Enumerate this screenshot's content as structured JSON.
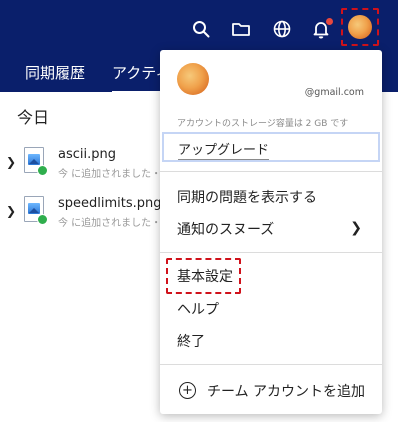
{
  "tabs": [
    {
      "label": "同期履歴"
    },
    {
      "label": "アクティ"
    }
  ],
  "section": {
    "today": "今日"
  },
  "files": [
    {
      "name": "ascii.png",
      "sub": "今 に追加されました・"
    },
    {
      "name": "speedlimits.png",
      "sub": "今 に追加されました・"
    }
  ],
  "account": {
    "email": "@gmail.com",
    "storage": "アカウントのストレージ容量は 2 GB です"
  },
  "menu": {
    "upgrade": "アップグレード",
    "sync_issues": "同期の問題を表示する",
    "snooze": "通知のスヌーズ",
    "settings": "基本設定",
    "help": "ヘルプ",
    "quit": "終了",
    "add_team": "チーム アカウントを追加"
  },
  "icons": {
    "search": "search-icon",
    "folder": "folder-icon",
    "globe": "globe-icon",
    "bell": "bell-icon",
    "avatar": "avatar",
    "chevron": "chevron-right-icon",
    "add": "plus-circle-icon"
  },
  "colors": {
    "header_bg": "#0a1f6b",
    "highlight": "#d0121b",
    "notification": "#e8483e",
    "upgrade_border": "#c5d5f5",
    "synced": "#2fae4d"
  }
}
